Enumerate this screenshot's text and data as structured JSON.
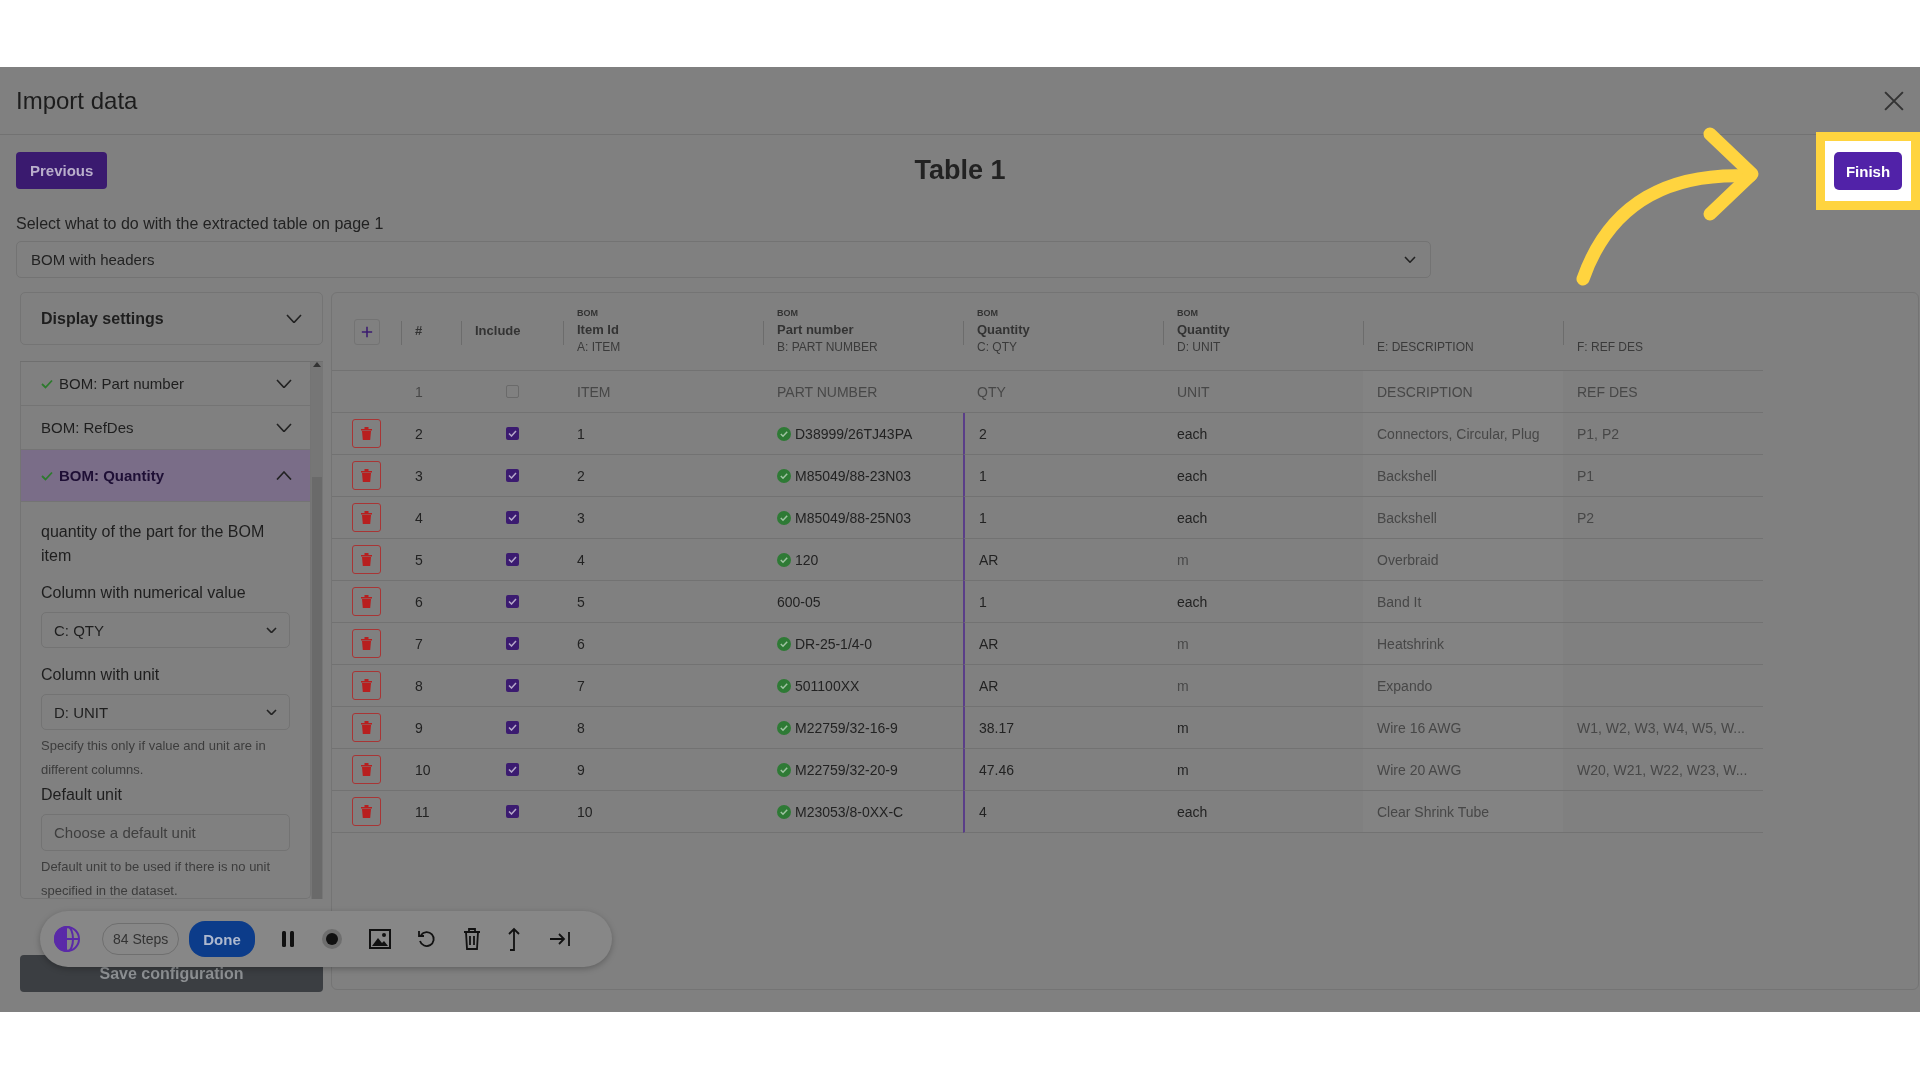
{
  "dialog": {
    "title": "Import data"
  },
  "nav": {
    "previous_button": "Previous",
    "table_title": "Table 1",
    "finish_button": "Finish",
    "finish_highlighted": true
  },
  "prompt": "Select what to do with the extracted table on page 1",
  "mode_select": {
    "value": "BOM with headers"
  },
  "sidebar": {
    "display_settings": "Display settings",
    "items": [
      {
        "label": "BOM: Part number",
        "checked": true,
        "expanded": false,
        "selected": false
      },
      {
        "label": "BOM: RefDes",
        "checked": false,
        "expanded": false,
        "selected": false
      },
      {
        "label": "BOM: Quantity",
        "checked": true,
        "expanded": true,
        "selected": true
      }
    ],
    "detail": {
      "description": "quantity of the part for the BOM item",
      "fields": [
        {
          "kind": "select",
          "label": "Column with numerical value",
          "value": "C: QTY"
        },
        {
          "kind": "select",
          "label": "Column with unit",
          "value": "D: UNIT",
          "hint": "Specify this only if value and unit are in different columns."
        },
        {
          "kind": "input",
          "label": "Default unit",
          "placeholder": "Choose a default unit",
          "hint": "Default unit to be used if there is no unit specified in the dataset."
        }
      ]
    },
    "save_button": "Save configuration"
  },
  "table": {
    "number_header": "#",
    "include_header": "Include",
    "columns": [
      {
        "group": "BOM",
        "title": "Item Id",
        "source": "A: ITEM"
      },
      {
        "group": "BOM",
        "title": "Part number",
        "source": "B: PART NUMBER"
      },
      {
        "group": "BOM",
        "title": "Quantity",
        "source": "C: QTY"
      },
      {
        "group": "BOM",
        "title": "Quantity",
        "source": "D: UNIT"
      },
      {
        "source": "E: DESCRIPTION"
      },
      {
        "source": "F: REF DES"
      }
    ],
    "rows": [
      {
        "kind": "source",
        "number": "1",
        "included": false,
        "item": "ITEM",
        "part": "PART NUMBER",
        "part_valid": false,
        "qty": "QTY",
        "unit": "UNIT",
        "unit_matched": false,
        "description": "DESCRIPTION",
        "ref_des": "REF DES"
      },
      {
        "kind": "data",
        "number": "2",
        "included": true,
        "item": "1",
        "part": "D38999/26TJ43PA",
        "part_valid": true,
        "qty": "2",
        "unit": "each",
        "unit_matched": true,
        "description": "Connectors, Circular, Plug",
        "ref_des": "P1, P2"
      },
      {
        "kind": "data",
        "number": "3",
        "included": true,
        "item": "2",
        "part": "M85049/88-23N03",
        "part_valid": true,
        "qty": "1",
        "unit": "each",
        "unit_matched": true,
        "description": "Backshell",
        "ref_des": "P1"
      },
      {
        "kind": "data",
        "number": "4",
        "included": true,
        "item": "3",
        "part": "M85049/88-25N03",
        "part_valid": true,
        "qty": "1",
        "unit": "each",
        "unit_matched": true,
        "description": "Backshell",
        "ref_des": "P2"
      },
      {
        "kind": "data",
        "number": "5",
        "included": true,
        "item": "4",
        "part": "120",
        "part_valid": true,
        "qty": "AR",
        "unit": "m",
        "unit_matched": false,
        "description": "Overbraid"
      },
      {
        "kind": "data",
        "number": "6",
        "included": true,
        "item": "5",
        "part": "600-05",
        "part_valid": false,
        "qty": "1",
        "unit": "each",
        "unit_matched": true,
        "description": "Band It"
      },
      {
        "kind": "data",
        "number": "7",
        "included": true,
        "item": "6",
        "part": "DR-25-1/4-0",
        "part_valid": true,
        "qty": "AR",
        "unit": "m",
        "unit_matched": false,
        "description": "Heatshrink"
      },
      {
        "kind": "data",
        "number": "8",
        "included": true,
        "item": "7",
        "part": "501100XX",
        "part_valid": true,
        "qty": "AR",
        "unit": "m",
        "unit_matched": false,
        "description": "Expando"
      },
      {
        "kind": "data",
        "number": "9",
        "included": true,
        "item": "8",
        "part": "M22759/32-16-9",
        "part_valid": true,
        "qty": "38.17",
        "unit": "m",
        "unit_matched": true,
        "description": "Wire 16 AWG",
        "ref_des": "W1, W2, W3, W4, W5, W..."
      },
      {
        "kind": "data",
        "number": "10",
        "included": true,
        "item": "9",
        "part": "M22759/32-20-9",
        "part_valid": true,
        "qty": "47.46",
        "unit": "m",
        "unit_matched": true,
        "description": "Wire 20 AWG",
        "ref_des": "W20, W21, W22, W23, W..."
      },
      {
        "kind": "data",
        "number": "11",
        "included": true,
        "item": "10",
        "part": "M23053/8-0XX-C",
        "part_valid": true,
        "qty": "4",
        "unit": "each",
        "unit_matched": true,
        "description": "Clear Shrink Tube"
      }
    ]
  },
  "toolbar": {
    "steps": "84 Steps",
    "done_button": "Done"
  }
}
